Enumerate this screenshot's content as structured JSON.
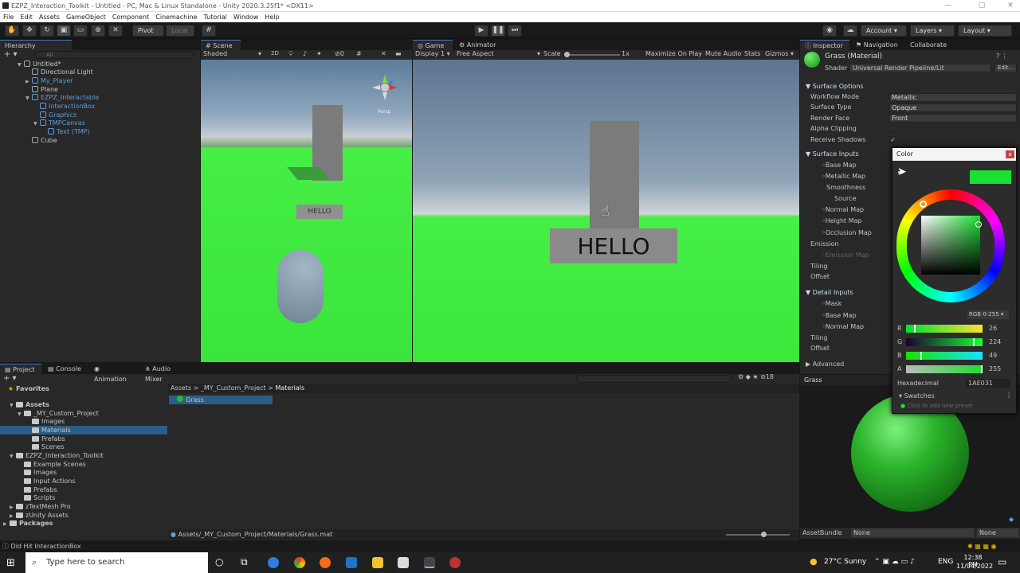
{
  "window": {
    "title": "EZPZ_Interaction_Toolkit - Untitled - PC, Mac & Linux Standalone - Unity 2020.3.25f1* <DX11>"
  },
  "menu": [
    "File",
    "Edit",
    "Assets",
    "GameObject",
    "Component",
    "Cinemachine",
    "Tutorial",
    "Window",
    "Help"
  ],
  "toolbar": {
    "pivot": "Pivot",
    "local": "Local",
    "account": "Account",
    "layers": "Layers",
    "layout": "Layout"
  },
  "hierarchy": {
    "tab": "Hierarchy",
    "search": "All",
    "items": [
      {
        "label": "Untitled*"
      },
      {
        "label": "Directional Light"
      },
      {
        "label": "My_Player"
      },
      {
        "label": "Plane"
      },
      {
        "label": "EZPZ_Interactable"
      },
      {
        "label": "InteractionBox"
      },
      {
        "label": "Graphics"
      },
      {
        "label": "TMPCanvas"
      },
      {
        "label": "Text (TMP)"
      },
      {
        "label": "Cube"
      }
    ]
  },
  "scene": {
    "tab": "Scene",
    "shading": "Shaded",
    "mode2d": "2D",
    "gizmo_count": "0",
    "persp": "Persp",
    "sign_text": "HELLO"
  },
  "game": {
    "tab": "Game",
    "animator_tab": "Animator",
    "display": "Display 1",
    "aspect": "Free Aspect",
    "scale_label": "Scale",
    "scale_value": "1x",
    "maximize": "Maximize On Play",
    "mute": "Mute Audio",
    "stats": "Stats",
    "gizmos": "Gizmos",
    "sign_text": "HELLO"
  },
  "inspector": {
    "tabs": [
      "Inspector",
      "Navigation",
      "Collaborate"
    ],
    "material_name": "Grass (Material)",
    "shader_label": "Shader",
    "shader_value": "Universal Render Pipeline/Lit",
    "edit": "Edit...",
    "surface_options": "Surface Options",
    "workflow_label": "Workflow Mode",
    "workflow_value": "Metallic",
    "surface_type_label": "Surface Type",
    "surface_type_value": "Opaque",
    "render_face_label": "Render Face",
    "render_face_value": "Front",
    "alpha_clipping": "Alpha Clipping",
    "receive_shadows": "Receive Shadows",
    "surface_inputs": "Surface Inputs",
    "base_map": "Base Map",
    "metallic_map": "Metallic Map",
    "smoothness": "Smoothness",
    "source": "Source",
    "normal_map": "Normal Map",
    "height_map": "Height Map",
    "occlusion_map": "Occlusion Map",
    "emission": "Emission",
    "emission_map": "Emission Map",
    "tiling": "Tiling",
    "offset": "Offset",
    "detail_inputs": "Detail Inputs",
    "mask": "Mask",
    "detail_base_map": "Base Map",
    "detail_normal_map": "Normal Map",
    "detail_tiling": "Tiling",
    "detail_offset": "Offset",
    "advanced": "Advanced",
    "preview_label": "Grass",
    "assetbundle_label": "AssetBundle",
    "assetbundle_value": "None",
    "assetbundle_variant": "None"
  },
  "color_picker": {
    "title": "Color",
    "mode": "RGB 0-255",
    "r_label": "R",
    "r": "26",
    "g_label": "G",
    "g": "224",
    "b_label": "B",
    "b": "49",
    "a_label": "A",
    "a": "255",
    "hex_label": "Hexadecimal",
    "hex": "1AE031",
    "swatches": "Swatches",
    "add_preset": "Click to add new preset",
    "color": "#1ae031"
  },
  "project": {
    "tabs": [
      "Project",
      "Console",
      "Animation",
      "Audio Mixer"
    ],
    "favorites": "Favorites",
    "tree": [
      {
        "label": "Assets"
      },
      {
        "label": "_MY_Custom_Project"
      },
      {
        "label": "Images"
      },
      {
        "label": "Materials"
      },
      {
        "label": "Prefabs"
      },
      {
        "label": "Scenes"
      },
      {
        "label": "EZPZ_Interaction_Toolkit"
      },
      {
        "label": "Example Scenes"
      },
      {
        "label": "Images"
      },
      {
        "label": "Input Actions"
      },
      {
        "label": "Prefabs"
      },
      {
        "label": "Scripts"
      },
      {
        "label": "zTextMesh Pro"
      },
      {
        "label": "zUnity Assets"
      },
      {
        "label": "Packages"
      }
    ],
    "breadcrumb": [
      "Assets",
      "_MY_Custom_Project",
      "Materials"
    ],
    "asset": "Grass",
    "path": "Assets/_MY_Custom_Project/Materials/Grass.mat",
    "hidden_count": "18"
  },
  "status": {
    "message": "Did Hit InteractionBox"
  },
  "taskbar": {
    "search": "Type here to search",
    "weather": "27°C  Sunny",
    "lang": "ENG",
    "time": "12:38 PM",
    "date": "11/04/2022"
  }
}
